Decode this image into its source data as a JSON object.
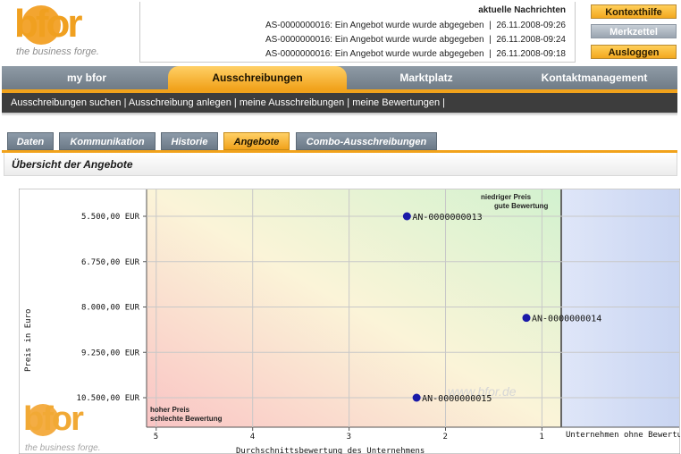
{
  "logo": {
    "text": "bfor",
    "tagline": "the business forge."
  },
  "news": {
    "title": "aktuelle Nachrichten",
    "items": [
      {
        "text": "AS-0000000016: Ein Angebot wurde wurde abgegeben",
        "date": "26.11.2008-09:26"
      },
      {
        "text": "AS-0000000016: Ein Angebot wurde wurde abgegeben",
        "date": "26.11.2008-09:24"
      },
      {
        "text": "AS-0000000016: Ein Angebot wurde wurde abgegeben",
        "date": "26.11.2008-09:18"
      }
    ]
  },
  "side_buttons": {
    "context_help": "Kontexthilfe",
    "notepad": "Merkzettel",
    "logout": "Ausloggen"
  },
  "nav": {
    "tabs": [
      "my bfor",
      "Ausschreibungen",
      "Marktplatz",
      "Kontaktmanagement"
    ],
    "active": "Ausschreibungen"
  },
  "subnav": {
    "text": "Ausschreibungen suchen | Ausschreibung anlegen | meine Ausschreibungen | meine Bewertungen |"
  },
  "tabs": {
    "items": [
      "Daten",
      "Kommunikation",
      "Historie",
      "Angebote",
      "Combo-Ausschreibungen"
    ],
    "active": "Angebote"
  },
  "section": {
    "title": "Übersicht der Angebote"
  },
  "colors": {
    "accent": "#f1a21b",
    "nav": "#7b8792",
    "dark_bar": "#3d3d3d"
  },
  "chart_data": {
    "type": "scatter",
    "xlabel": "Durchschnittsbewertung des Unternehmens",
    "ylabel": "Preis in Euro",
    "x_ticks": [
      "5",
      "4",
      "3",
      "2",
      "1"
    ],
    "y_ticks": [
      "5.500,00 EUR",
      "6.750,00 EUR",
      "8.000,00 EUR",
      "9.250,00 EUR",
      "10.500,00 EUR"
    ],
    "xlim": [
      5.1,
      0.8
    ],
    "ylim": [
      5500,
      10500
    ],
    "x_reversed": true,
    "y_reversed": true,
    "no_rating_label": "Unternehmen ohne Bewertung",
    "corner_top_right": [
      "niedriger Preis",
      "gute Bewertung"
    ],
    "corner_bottom_left": [
      "hoher Preis",
      "schlechte Bewertung"
    ],
    "watermark": "www.bfor.de",
    "grid": true,
    "points": [
      {
        "label": "AN-0000000013",
        "x": 2.4,
        "y": 5500
      },
      {
        "label": "AN-0000000014",
        "x": null,
        "y": 8300,
        "no_rating": true
      },
      {
        "label": "AN-0000000015",
        "x": 2.3,
        "y": 10500
      }
    ]
  }
}
